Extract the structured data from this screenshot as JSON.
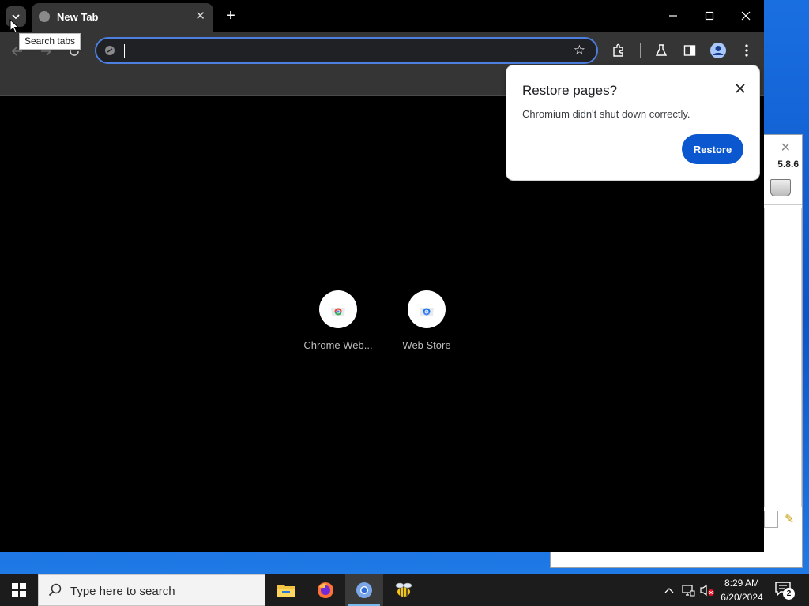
{
  "browser": {
    "tab": {
      "title": "New Tab"
    },
    "tooltip": "Search tabs",
    "omnibox": {
      "value": "",
      "placeholder": ""
    },
    "shortcuts": [
      {
        "label": "Chrome Web..."
      },
      {
        "label": "Web Store"
      }
    ]
  },
  "popup": {
    "title": "Restore pages?",
    "message": "Chromium didn't shut down correctly.",
    "restore_label": "Restore"
  },
  "background_window": {
    "version": "5.8.6"
  },
  "taskbar": {
    "search_placeholder": "Type here to search",
    "time": "8:29 AM",
    "date": "6/20/2024",
    "notification_count": "2"
  },
  "colors": {
    "accent": "#0b57d0",
    "omnibox_focus": "#4c7fe0",
    "toolbar": "#353535"
  }
}
